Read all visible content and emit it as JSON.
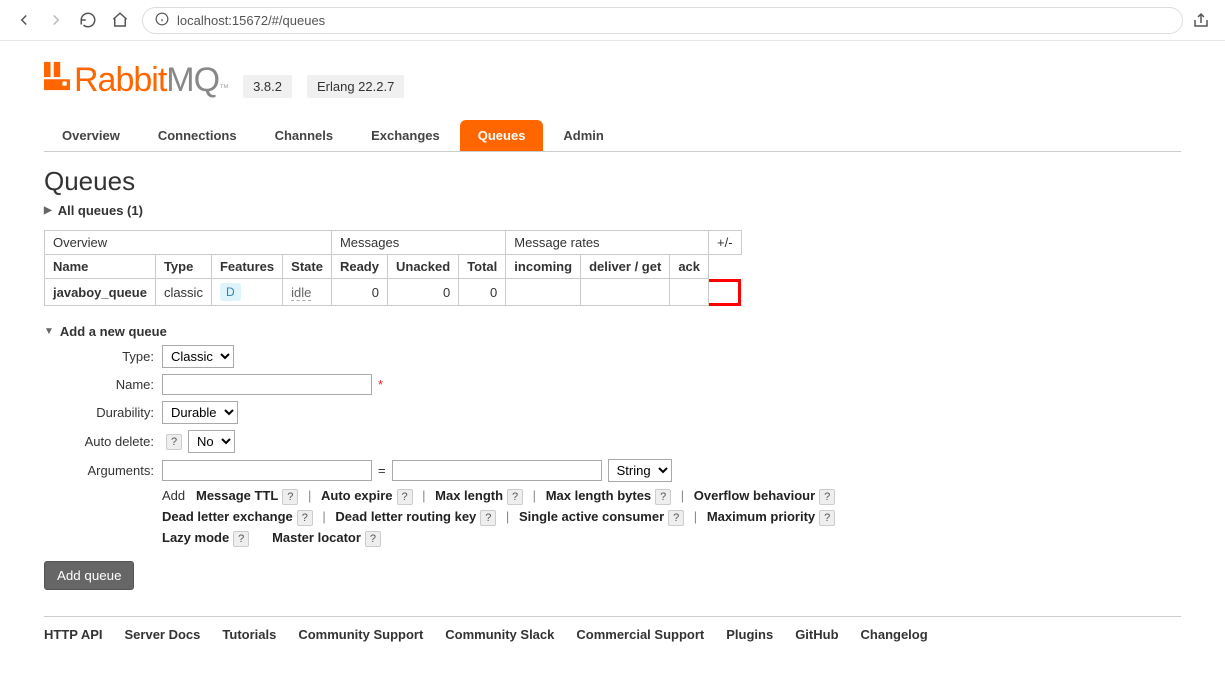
{
  "browser": {
    "url": "localhost:15672/#/queues"
  },
  "header": {
    "version": "3.8.2",
    "erlang": "Erlang 22.2.7"
  },
  "navTabs": [
    "Overview",
    "Connections",
    "Channels",
    "Exchanges",
    "Queues",
    "Admin"
  ],
  "activeTab": "Queues",
  "page": {
    "title": "Queues",
    "allQueues": "All queues (1)"
  },
  "tableGroups": {
    "overview": "Overview",
    "messages": "Messages",
    "rates": "Message rates",
    "plusminus": "+/-"
  },
  "columns": {
    "name": "Name",
    "type": "Type",
    "features": "Features",
    "state": "State",
    "ready": "Ready",
    "unacked": "Unacked",
    "total": "Total",
    "incoming": "incoming",
    "deliver": "deliver / get",
    "ack": "ack"
  },
  "queues": [
    {
      "name": "javaboy_queue",
      "type": "classic",
      "feature": "D",
      "state": "idle",
      "ready": "0",
      "unacked": "0",
      "total": "0",
      "incoming": "",
      "deliver": "",
      "ack": ""
    }
  ],
  "addQueue": {
    "header": "Add a new queue",
    "labels": {
      "type": "Type:",
      "name": "Name:",
      "durability": "Durability:",
      "autoDelete": "Auto delete:",
      "arguments": "Arguments:"
    },
    "typeValue": "Classic",
    "durabilityValue": "Durable",
    "autoDeleteValue": "No",
    "nameValue": "",
    "argKey": "",
    "argEq": "=",
    "argVal": "",
    "argType": "String",
    "argAddLabel": "Add",
    "argLinks1": [
      "Message TTL",
      "Auto expire",
      "Max length",
      "Max length bytes",
      "Overflow behaviour"
    ],
    "argLinks2": [
      "Dead letter exchange",
      "Dead letter routing key",
      "Single active consumer",
      "Maximum priority"
    ],
    "argLinks3": [
      "Lazy mode",
      "Master locator"
    ],
    "submit": "Add queue"
  },
  "footer": [
    "HTTP API",
    "Server Docs",
    "Tutorials",
    "Community Support",
    "Community Slack",
    "Commercial Support",
    "Plugins",
    "GitHub",
    "Changelog"
  ]
}
